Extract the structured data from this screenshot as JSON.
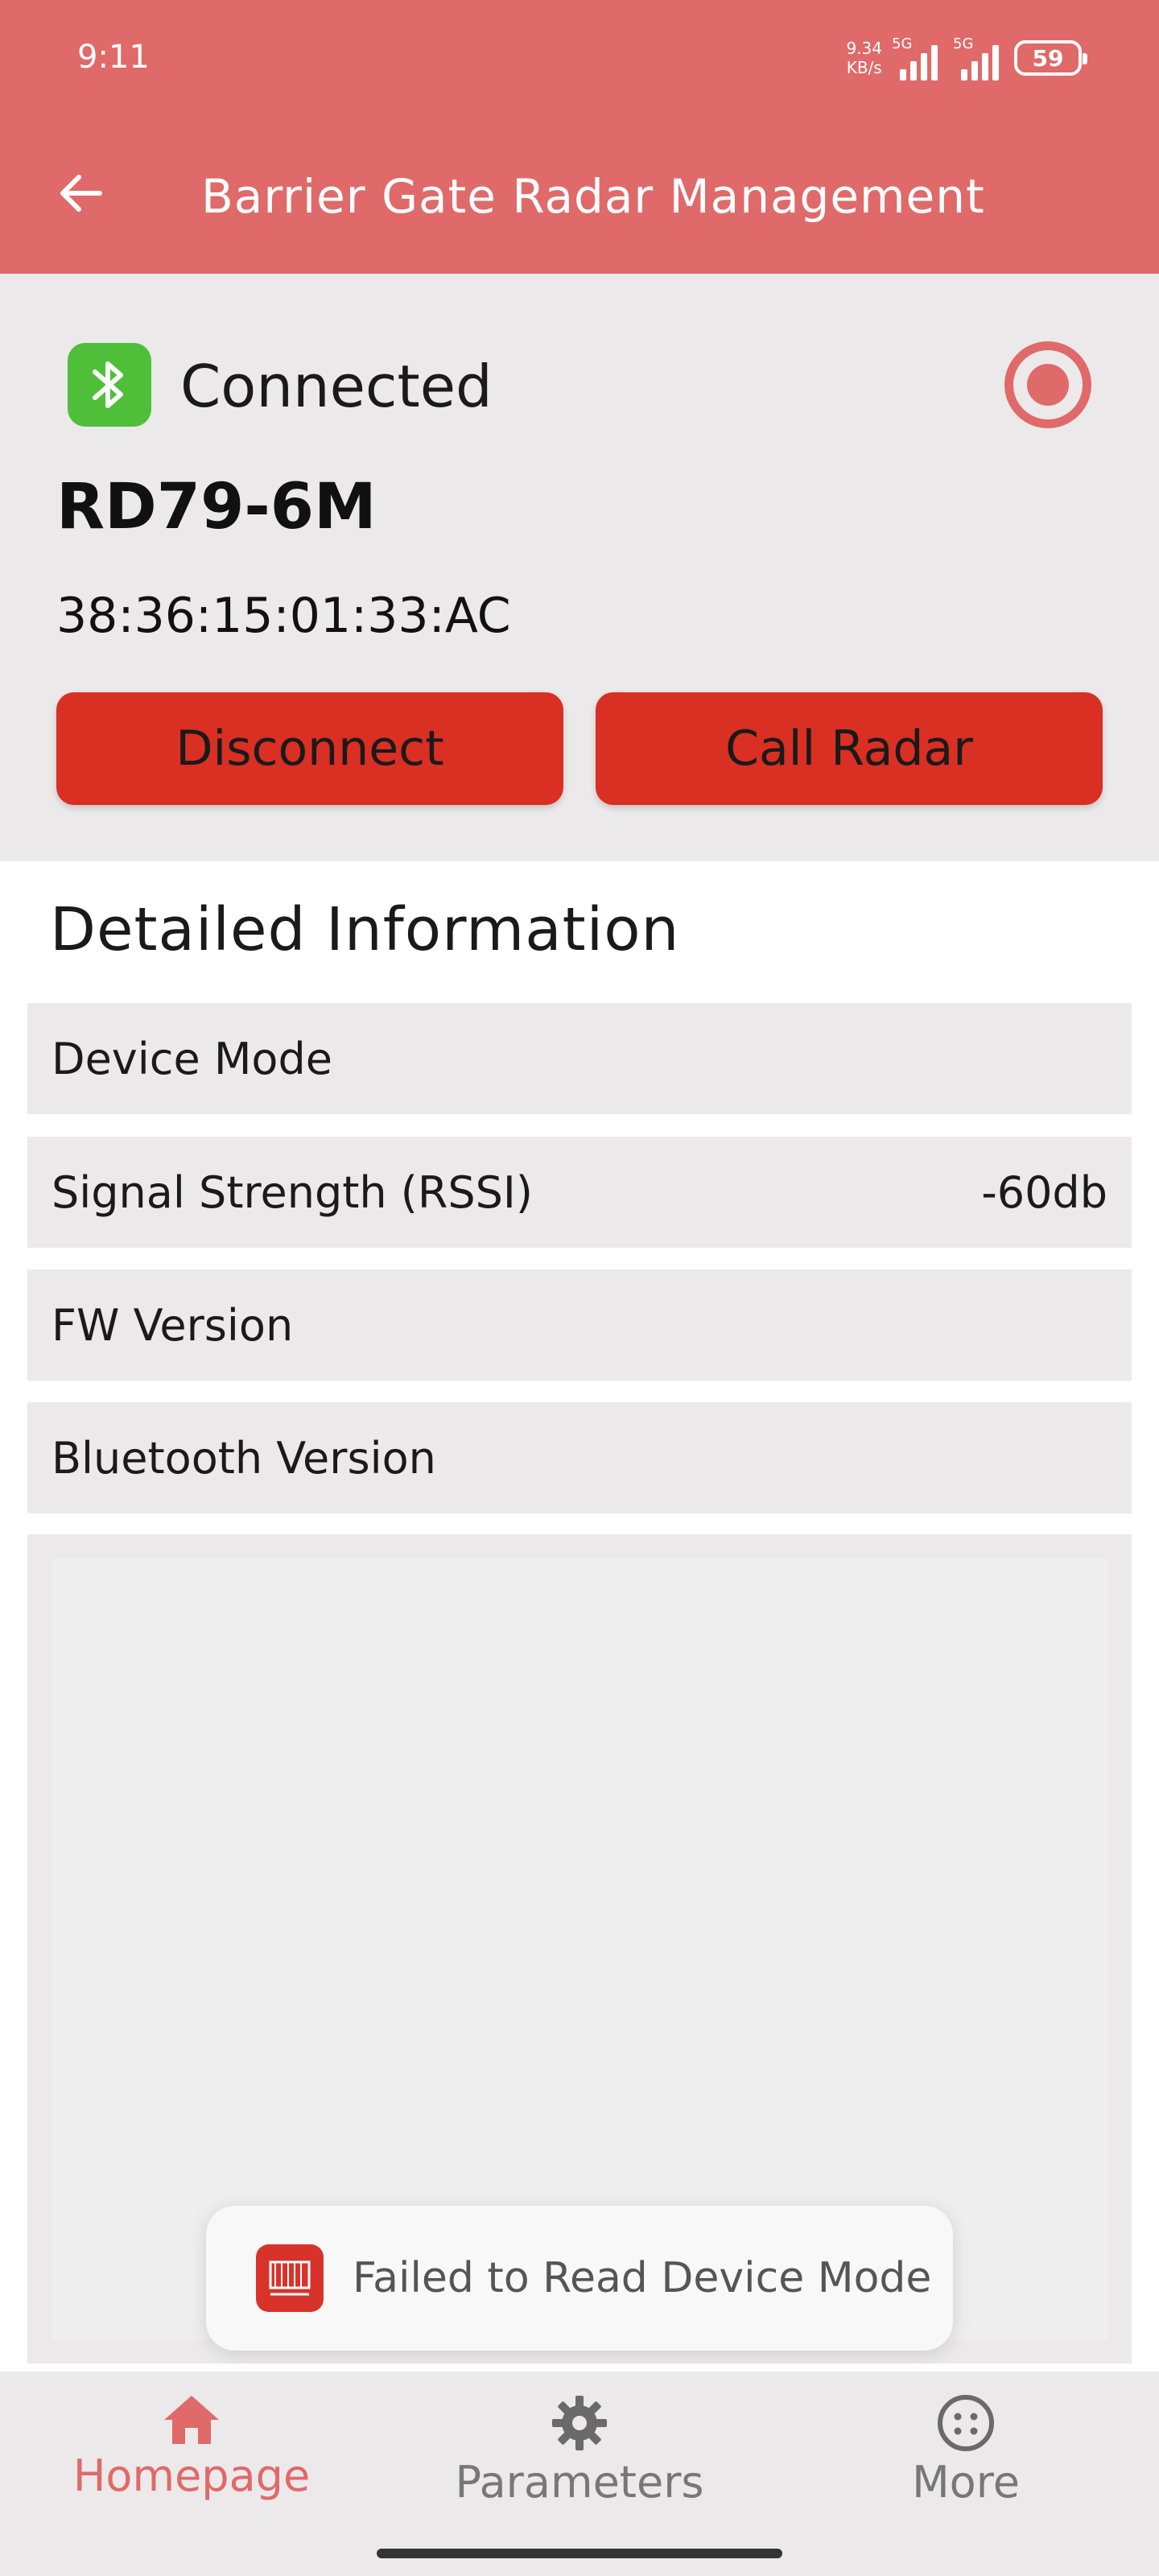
{
  "status_bar": {
    "time": "9:11",
    "net_speed_value": "9.34",
    "net_speed_unit": "KB/s",
    "sim1_label": "5G",
    "sim2_label": "5G",
    "battery": "59"
  },
  "header": {
    "title": "Barrier Gate Radar Management"
  },
  "connection": {
    "status": "Connected",
    "device_name": "RD79-6M",
    "mac_address": "38:36:15:01:33:AC",
    "disconnect_label": "Disconnect",
    "call_radar_label": "Call Radar"
  },
  "details": {
    "title": "Detailed Information",
    "rows": [
      {
        "label": "Device Mode",
        "value": ""
      },
      {
        "label": "Signal Strength (RSSI)",
        "value": "-60db"
      },
      {
        "label": "FW Version",
        "value": ""
      },
      {
        "label": "Bluetooth Version",
        "value": ""
      }
    ]
  },
  "toast": {
    "message": "Failed to Read Device Mode"
  },
  "bottom_nav": {
    "items": [
      {
        "label": "Homepage",
        "icon": "home-icon",
        "active": true
      },
      {
        "label": "Parameters",
        "icon": "gear-icon",
        "active": false
      },
      {
        "label": "More",
        "icon": "more-icon",
        "active": false
      }
    ]
  },
  "colors": {
    "header": "#df6a69",
    "button": "#da2f23",
    "bluetooth_badge": "#4fbf3a",
    "panel": "#ebe9e9",
    "nav_active": "#df6a69"
  }
}
